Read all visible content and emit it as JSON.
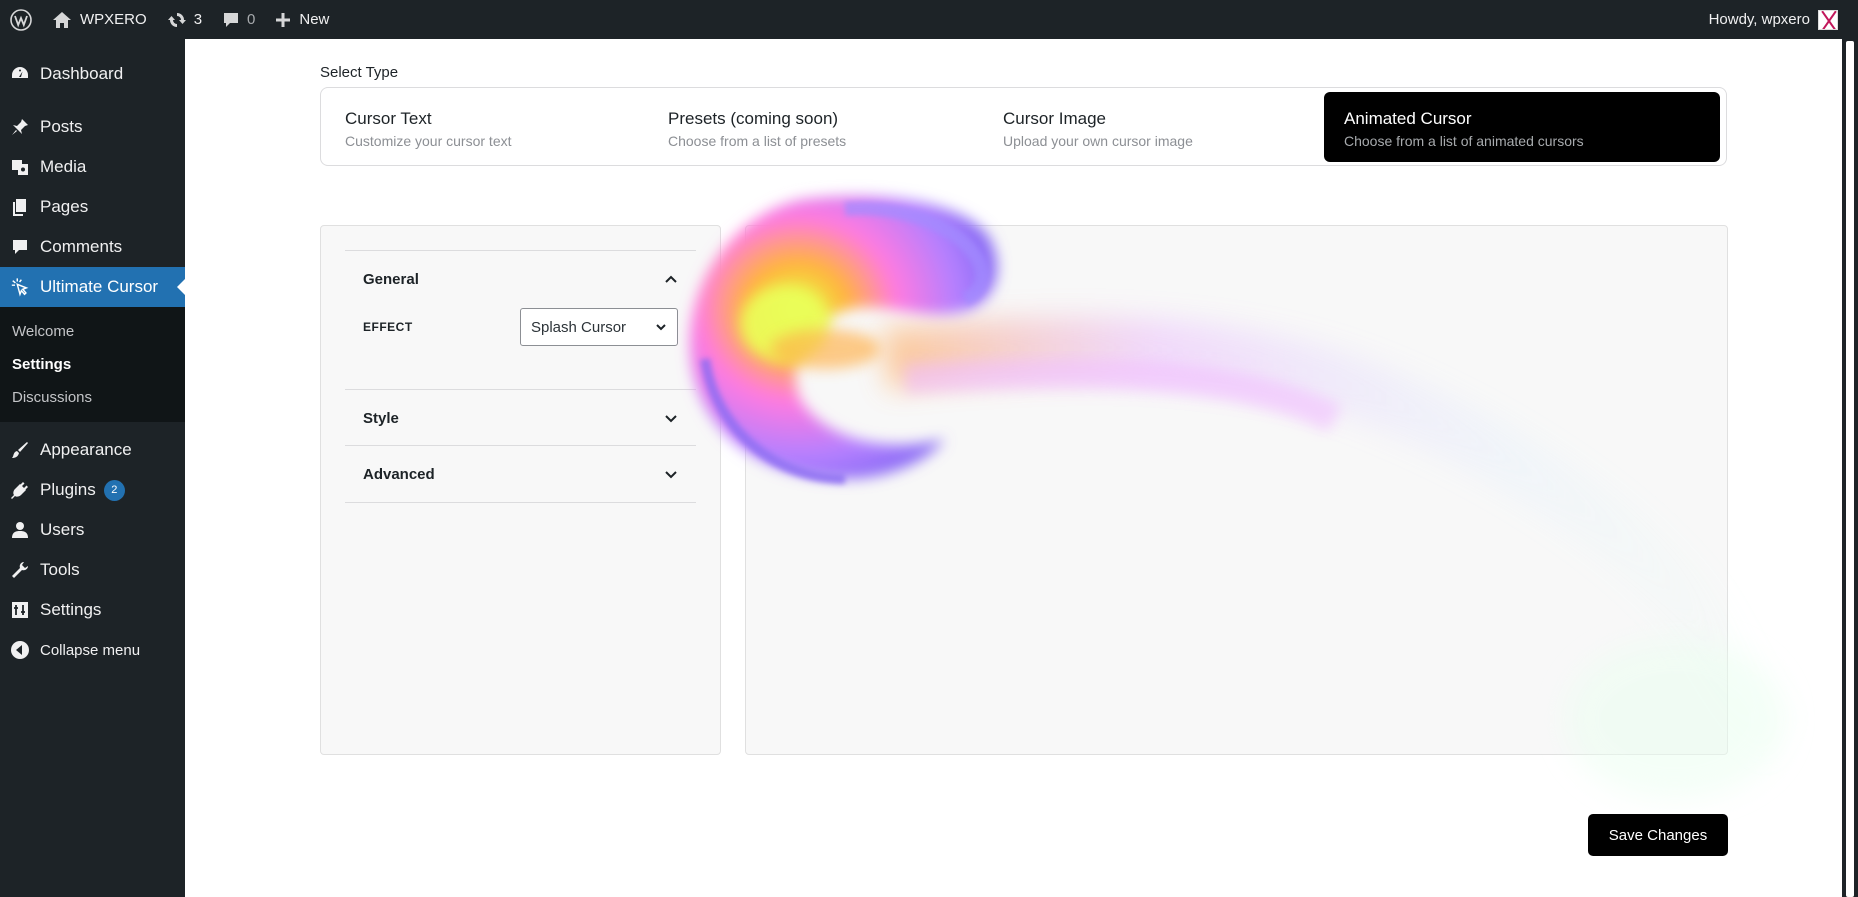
{
  "adminbar": {
    "site_name": "WPXERO",
    "updates_count": "3",
    "comments_count": "0",
    "new_label": "New",
    "howdy": "Howdy, wpxero"
  },
  "sidebar": {
    "items": [
      {
        "label": "Dashboard",
        "icon": "dashboard-icon"
      },
      {
        "label": "Posts",
        "icon": "pin-icon"
      },
      {
        "label": "Media",
        "icon": "media-icon"
      },
      {
        "label": "Pages",
        "icon": "pages-icon"
      },
      {
        "label": "Comments",
        "icon": "comment-icon"
      },
      {
        "label": "Ultimate Cursor",
        "icon": "cursor-click-icon",
        "current": true
      },
      {
        "label": "Appearance",
        "icon": "brush-icon"
      },
      {
        "label": "Plugins",
        "icon": "plug-icon",
        "badge": "2"
      },
      {
        "label": "Users",
        "icon": "user-icon"
      },
      {
        "label": "Tools",
        "icon": "wrench-icon"
      },
      {
        "label": "Settings",
        "icon": "sliders-icon"
      }
    ],
    "submenu": [
      {
        "label": "Welcome"
      },
      {
        "label": "Settings",
        "active": true
      },
      {
        "label": "Discussions"
      }
    ],
    "collapse_label": "Collapse menu"
  },
  "main": {
    "select_type_label": "Select Type",
    "type_cards": [
      {
        "title": "Cursor Text",
        "desc": "Customize your cursor text"
      },
      {
        "title": "Presets (coming soon)",
        "desc": "Choose from a list of presets"
      },
      {
        "title": "Cursor Image",
        "desc": "Upload your own cursor image"
      },
      {
        "title": "Animated Cursor",
        "desc": "Choose from a list of animated cursors",
        "active": true
      }
    ],
    "accordion": {
      "general": "General",
      "effect_label": "EFFECT",
      "effect_value": "Splash Cursor",
      "style": "Style",
      "advanced": "Advanced"
    },
    "save_label": "Save Changes"
  },
  "colors": {
    "accent": "#2271b1",
    "adminbar_bg": "#1d2327",
    "active_card": "#000000"
  }
}
